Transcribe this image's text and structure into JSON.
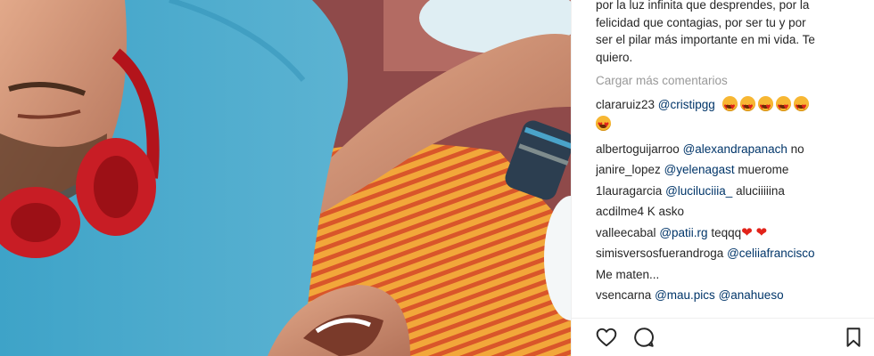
{
  "caption": {
    "lines": [
      "por la luz infinita que desprendes, por la",
      "felicidad que contagias, por ser tu y por",
      "ser el pilar más importante en mi vida. Te",
      "quiero."
    ]
  },
  "load_more_label": "Cargar más comentarios",
  "comments": [
    {
      "user": "clararuiz23",
      "mention": "@cristipgg",
      "text": "",
      "emoji_count": 6
    },
    {
      "user": "albertoguijarroo",
      "mention": "@alexandrapanach",
      "text": "no"
    },
    {
      "user": "janire_lopez",
      "mention": "@yelenagast",
      "text": "muerome"
    },
    {
      "user": "1lauragarcia",
      "mention": "@luciluciiia_",
      "text": "aluciiiiina"
    },
    {
      "user": "acdilme4",
      "mention": "",
      "text": "K asko"
    },
    {
      "user": "valleecabal",
      "mention": "@patii.rg",
      "text": "teqqq",
      "hearts": 2
    },
    {
      "user": "simisversosfuerandroga",
      "mention": "@celiiafrancisco",
      "text": "Me maten..."
    },
    {
      "user": "vsencarna",
      "mention": "@mau.pics",
      "text": "@anahueso"
    }
  ],
  "actions": {
    "like": "heart-outline-icon",
    "comment": "speech-bubble-icon",
    "save": "bookmark-icon"
  },
  "colors": {
    "mention": "#003569",
    "muted": "#999999",
    "text": "#262626"
  }
}
